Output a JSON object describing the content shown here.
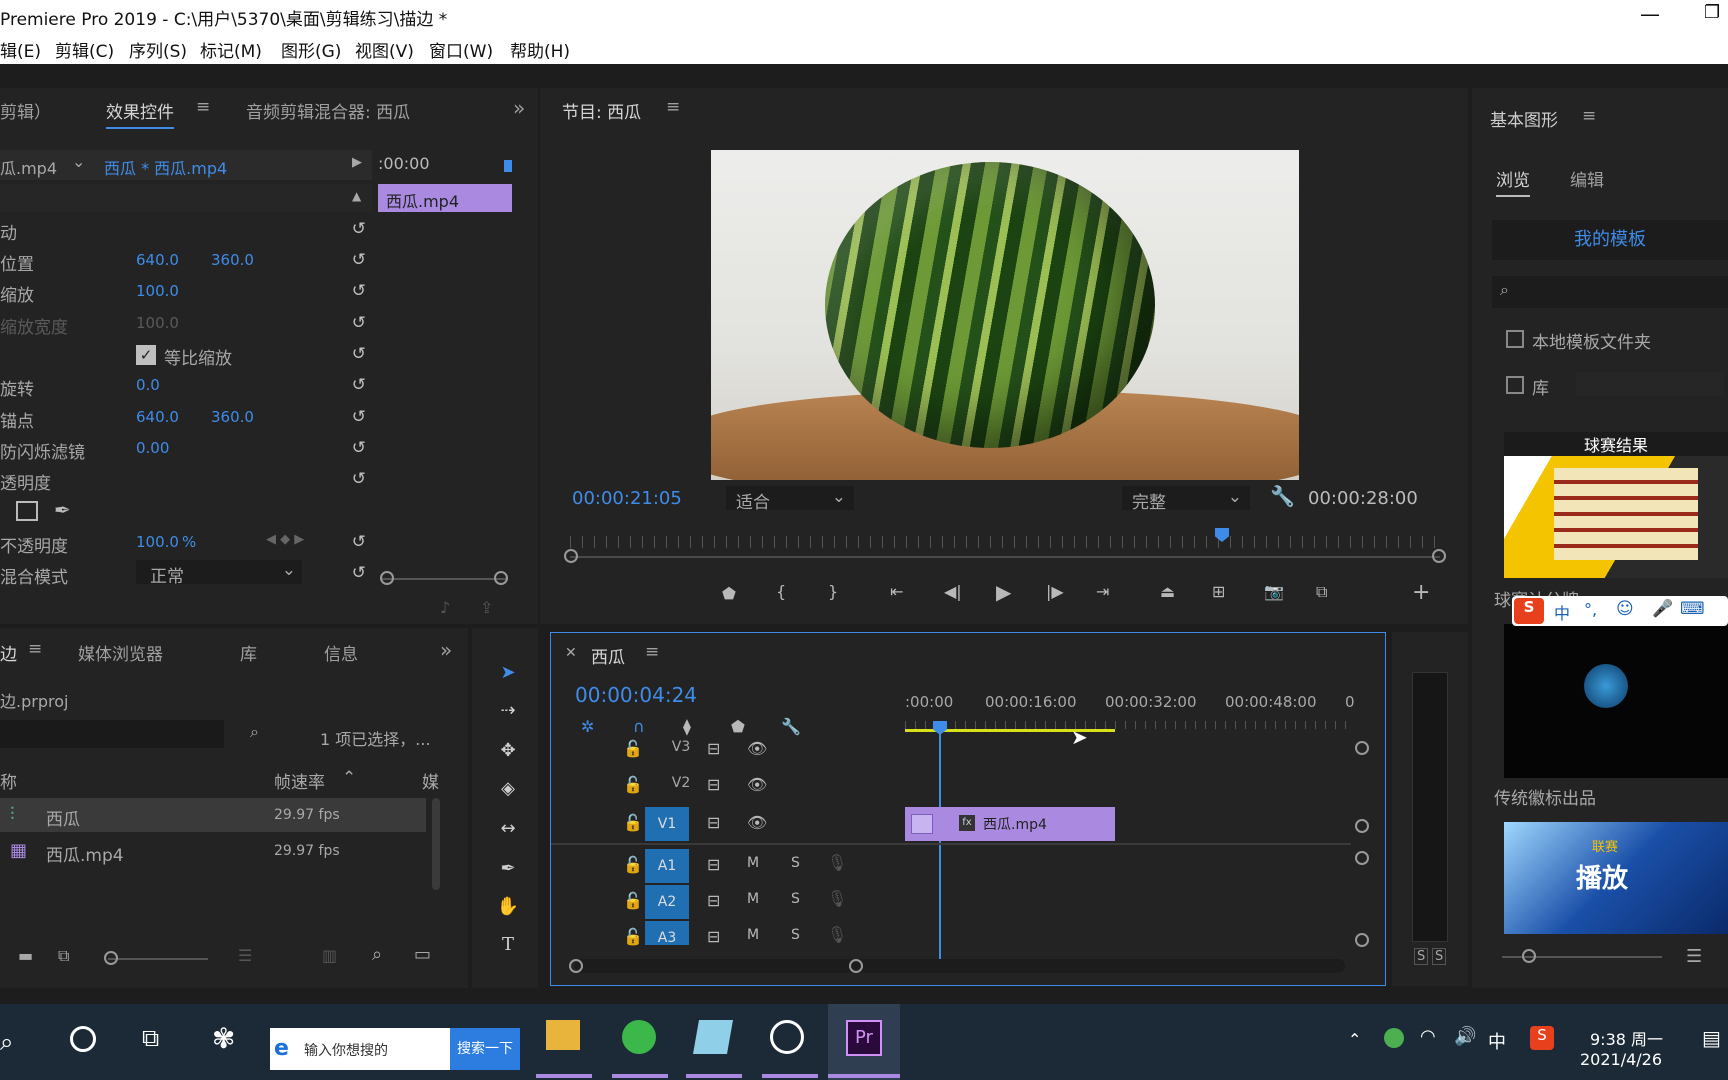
{
  "title": "Premiere Pro 2019 - C:\\用户\\5370\\桌面\\剪辑练习\\描边 *",
  "menu": [
    "辑(E)",
    "剪辑(C)",
    "序列(S)",
    "标记(M)",
    "图形(G)",
    "视图(V)",
    "窗口(W)",
    "帮助(H)"
  ],
  "effect_panel": {
    "tabs": [
      "剪辑）",
      "效果控件",
      "音频剪辑混合器: 西瓜"
    ],
    "source_left": "瓜.mp4",
    "source_right": "西瓜 * 西瓜.mp4",
    "time_head": ":00:00",
    "clip_label": "西瓜.mp4",
    "rows": [
      {
        "label": "动",
        "v1": "",
        "v2": ""
      },
      {
        "label": "位置",
        "v1": "640.0",
        "v2": "360.0"
      },
      {
        "label": "缩放",
        "v1": "100.0",
        "v2": ""
      },
      {
        "label": "缩放宽度",
        "v1": "100.0",
        "v2": ""
      },
      {
        "label": "",
        "v1": "",
        "v2": ""
      },
      {
        "label": "旋转",
        "v1": "0.0",
        "v2": ""
      },
      {
        "label": "锚点",
        "v1": "640.0",
        "v2": "360.0"
      },
      {
        "label": "防闪烁滤镜",
        "v1": "0.00",
        "v2": ""
      },
      {
        "label": "透明度",
        "v1": "",
        "v2": ""
      }
    ],
    "uniform_scale": "等比缩放",
    "opacity_label": "不透明度",
    "opacity_value": "100.0",
    "opacity_unit": "%",
    "blend_label": "混合模式",
    "blend_value": "正常"
  },
  "program": {
    "title": "节目: 西瓜",
    "current_time": "00:00:21:05",
    "fit": "适合",
    "quality": "完整",
    "duration": "00:00:28:00"
  },
  "graphics": {
    "title": "基本图形",
    "tab_browse": "浏览",
    "tab_edit": "编辑",
    "my_templates": "我的模板",
    "local_folder": "本地模板文件夹",
    "library": "库",
    "tpl1_title": "球赛结果",
    "tpl1_label": "球赛计分牌",
    "tpl2_label": "传统徽标出品",
    "tpl3_a": "联赛",
    "tpl3_b": "播放"
  },
  "project": {
    "tabs": [
      "边",
      "媒体浏览器",
      "库",
      "信息"
    ],
    "file": "边.prproj",
    "selected": "1 项已选择，...",
    "col_name": "称",
    "col_fps": "帧速率",
    "col_media": "媒",
    "items": [
      {
        "name": "西瓜",
        "fps": "29.97 fps"
      },
      {
        "name": "西瓜.mp4",
        "fps": "29.97 fps"
      }
    ]
  },
  "timeline": {
    "title": "西瓜",
    "timecode": "00:00:04:24",
    "ruler": [
      ":00:00",
      "00:00:16:00",
      "00:00:32:00",
      "00:00:48:00",
      "0"
    ],
    "video_tracks": [
      "V3",
      "V2",
      "V1"
    ],
    "audio_tracks": [
      "A1",
      "A2",
      "A3"
    ],
    "clip": "西瓜.mp4",
    "m": "M",
    "s": "S"
  },
  "meter": {
    "s1": "S",
    "s2": "S"
  },
  "ime": {
    "zh": "中",
    "dot": "°,"
  },
  "taskbar": {
    "search_placeholder": "输入你想搜的",
    "search_button": "搜索一下",
    "time": "9:38 周一",
    "date": "2021/4/26",
    "lang": "中"
  },
  "colors": {
    "accent": "#3f8ce8",
    "clip": "#a98ae0",
    "track_btn": "#1f6fb2"
  }
}
